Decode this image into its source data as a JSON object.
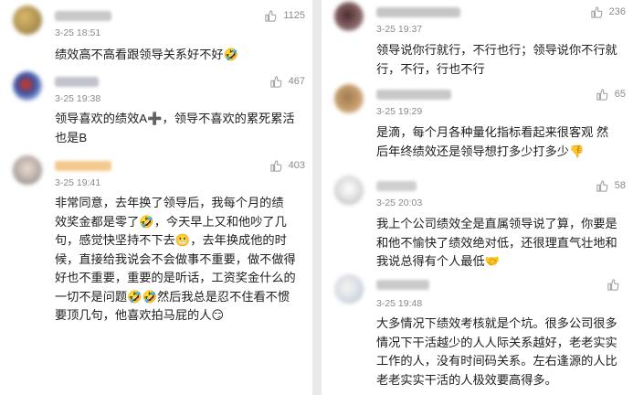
{
  "left": {
    "comments": [
      {
        "time": "3-25 18:51",
        "likes": "1125",
        "text": "绩效高不高看跟领导关系好不好🤣"
      },
      {
        "time": "3-25 19:38",
        "likes": "467",
        "text": "领导喜欢的绩效A➕，领导不喜欢的累死累活\n也是B"
      },
      {
        "time": "3-25 19:41",
        "likes": "403",
        "text": "非常同意，去年换了领导后，我每个月的绩\n效奖金都是零了🤣，今天早上又和他吵了几\n句，感觉快坚持不下去😬，去年换成他的时\n候，直接给我说会不会做事不重要，做不做得\n好也不重要，重要的是听话，工资奖金什么的\n一切不是问题🤣🤣然后我总是忍不住看不惯\n要顶几句，他喜欢拍马屁的人😏"
      }
    ]
  },
  "right": {
    "comments": [
      {
        "time": "3-25 19:37",
        "likes": "236",
        "text": "领导说你行就行，不行也行；领导说你不行就\n行，不行，行也不行"
      },
      {
        "time": "3-25 19:29",
        "likes": "65",
        "text": "是滴，每个月各种量化指标看起来很客观 然\n后年终绩效还是领导想打多少打多少👎"
      },
      {
        "time": "3-25 20:03",
        "likes": "58",
        "text": "我上个公司绩效全是直属领导说了算，你要是\n和他不愉快了绩效绝对低，还很理直气壮地和\n我说总得有个人最低🤝"
      },
      {
        "time": "3-25 19:48",
        "likes": "",
        "text": "大多情况下绩效考核就是个坑。很多公司很多\n情况下干活越少的人人际关系越好，老老实实\n工作的人，没有时间码关系。左右逢源的人比\n老老实实干活的人极效要高得多。"
      }
    ]
  },
  "colors": {
    "panel_bg": "#ffffff",
    "gap_bg": "#e9e9e9",
    "text": "#202020",
    "meta": "#8a8a8a"
  },
  "icons": {
    "like": "thumbs-up-icon"
  }
}
